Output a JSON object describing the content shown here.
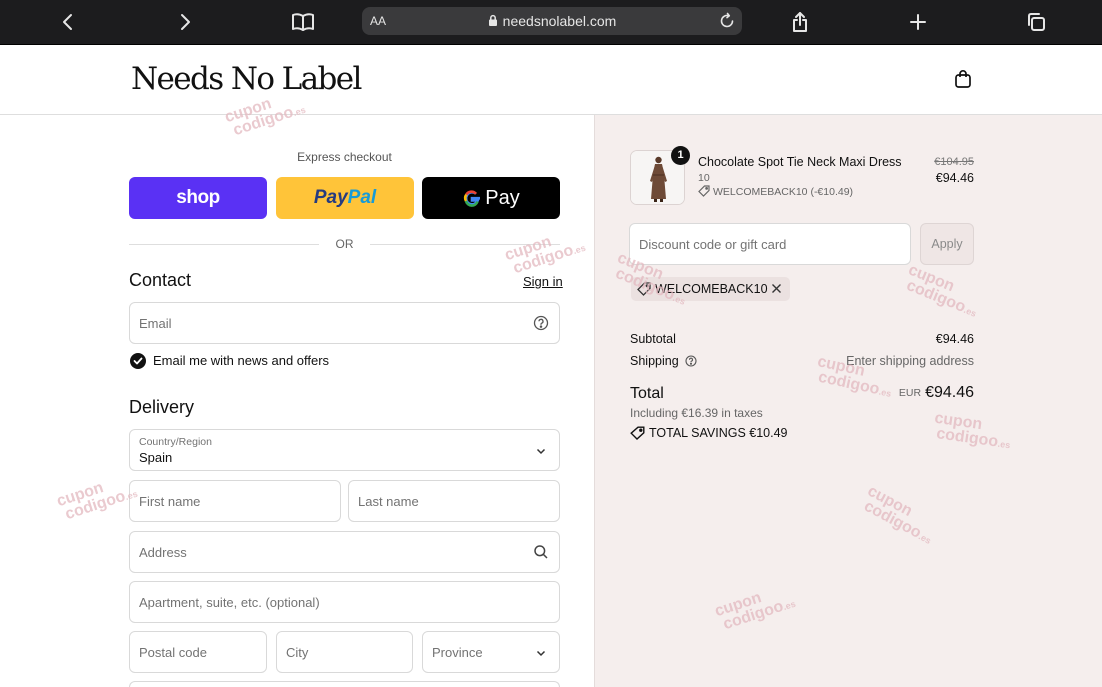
{
  "browser": {
    "text_size_label": "AA",
    "url": "needsnolabel.com"
  },
  "header": {
    "logo": "Needs No Label"
  },
  "express": {
    "label": "Express checkout",
    "shop_label": "shop",
    "paypal_part1": "Pay",
    "paypal_part2": "Pal",
    "gpay_label": "Pay",
    "gpay_g": "G",
    "divider": "OR"
  },
  "contact": {
    "heading": "Contact",
    "signin": "Sign in",
    "email_placeholder": "Email",
    "newsletter_label": "Email me with news and offers",
    "newsletter_checked": true
  },
  "delivery": {
    "heading": "Delivery",
    "country_label": "Country/Region",
    "country_value": "Spain",
    "first_name_placeholder": "First name",
    "last_name_placeholder": "Last name",
    "address_placeholder": "Address",
    "apartment_placeholder": "Apartment, suite, etc. (optional)",
    "postal_placeholder": "Postal code",
    "city_placeholder": "City",
    "province_placeholder": "Province"
  },
  "order": {
    "item": {
      "quantity": "1",
      "name": "Chocolate Spot Tie Neck Maxi Dress",
      "variant": "10",
      "discount_note": "WELCOMEBACK10 (-€10.49)",
      "original_price": "€104.95",
      "price": "€94.46"
    },
    "discount_placeholder": "Discount code or gift card",
    "apply_label": "Apply",
    "applied_code": "WELCOMEBACK10",
    "subtotal_label": "Subtotal",
    "subtotal_value": "€94.46",
    "shipping_label": "Shipping",
    "shipping_value": "Enter shipping address",
    "total_label": "Total",
    "currency": "EUR",
    "total_value": "€94.46",
    "tax_note": "Including €16.39 in taxes",
    "savings_label": "TOTAL SAVINGS",
    "savings_value": "€10.49"
  },
  "watermark": {
    "line1": "cupon",
    "line2": "codigoo",
    "suffix": ".es"
  },
  "colors": {
    "shop_purple": "#5a31f4",
    "paypal_yellow": "#ffc439",
    "summary_bg": "#f5eeed"
  }
}
